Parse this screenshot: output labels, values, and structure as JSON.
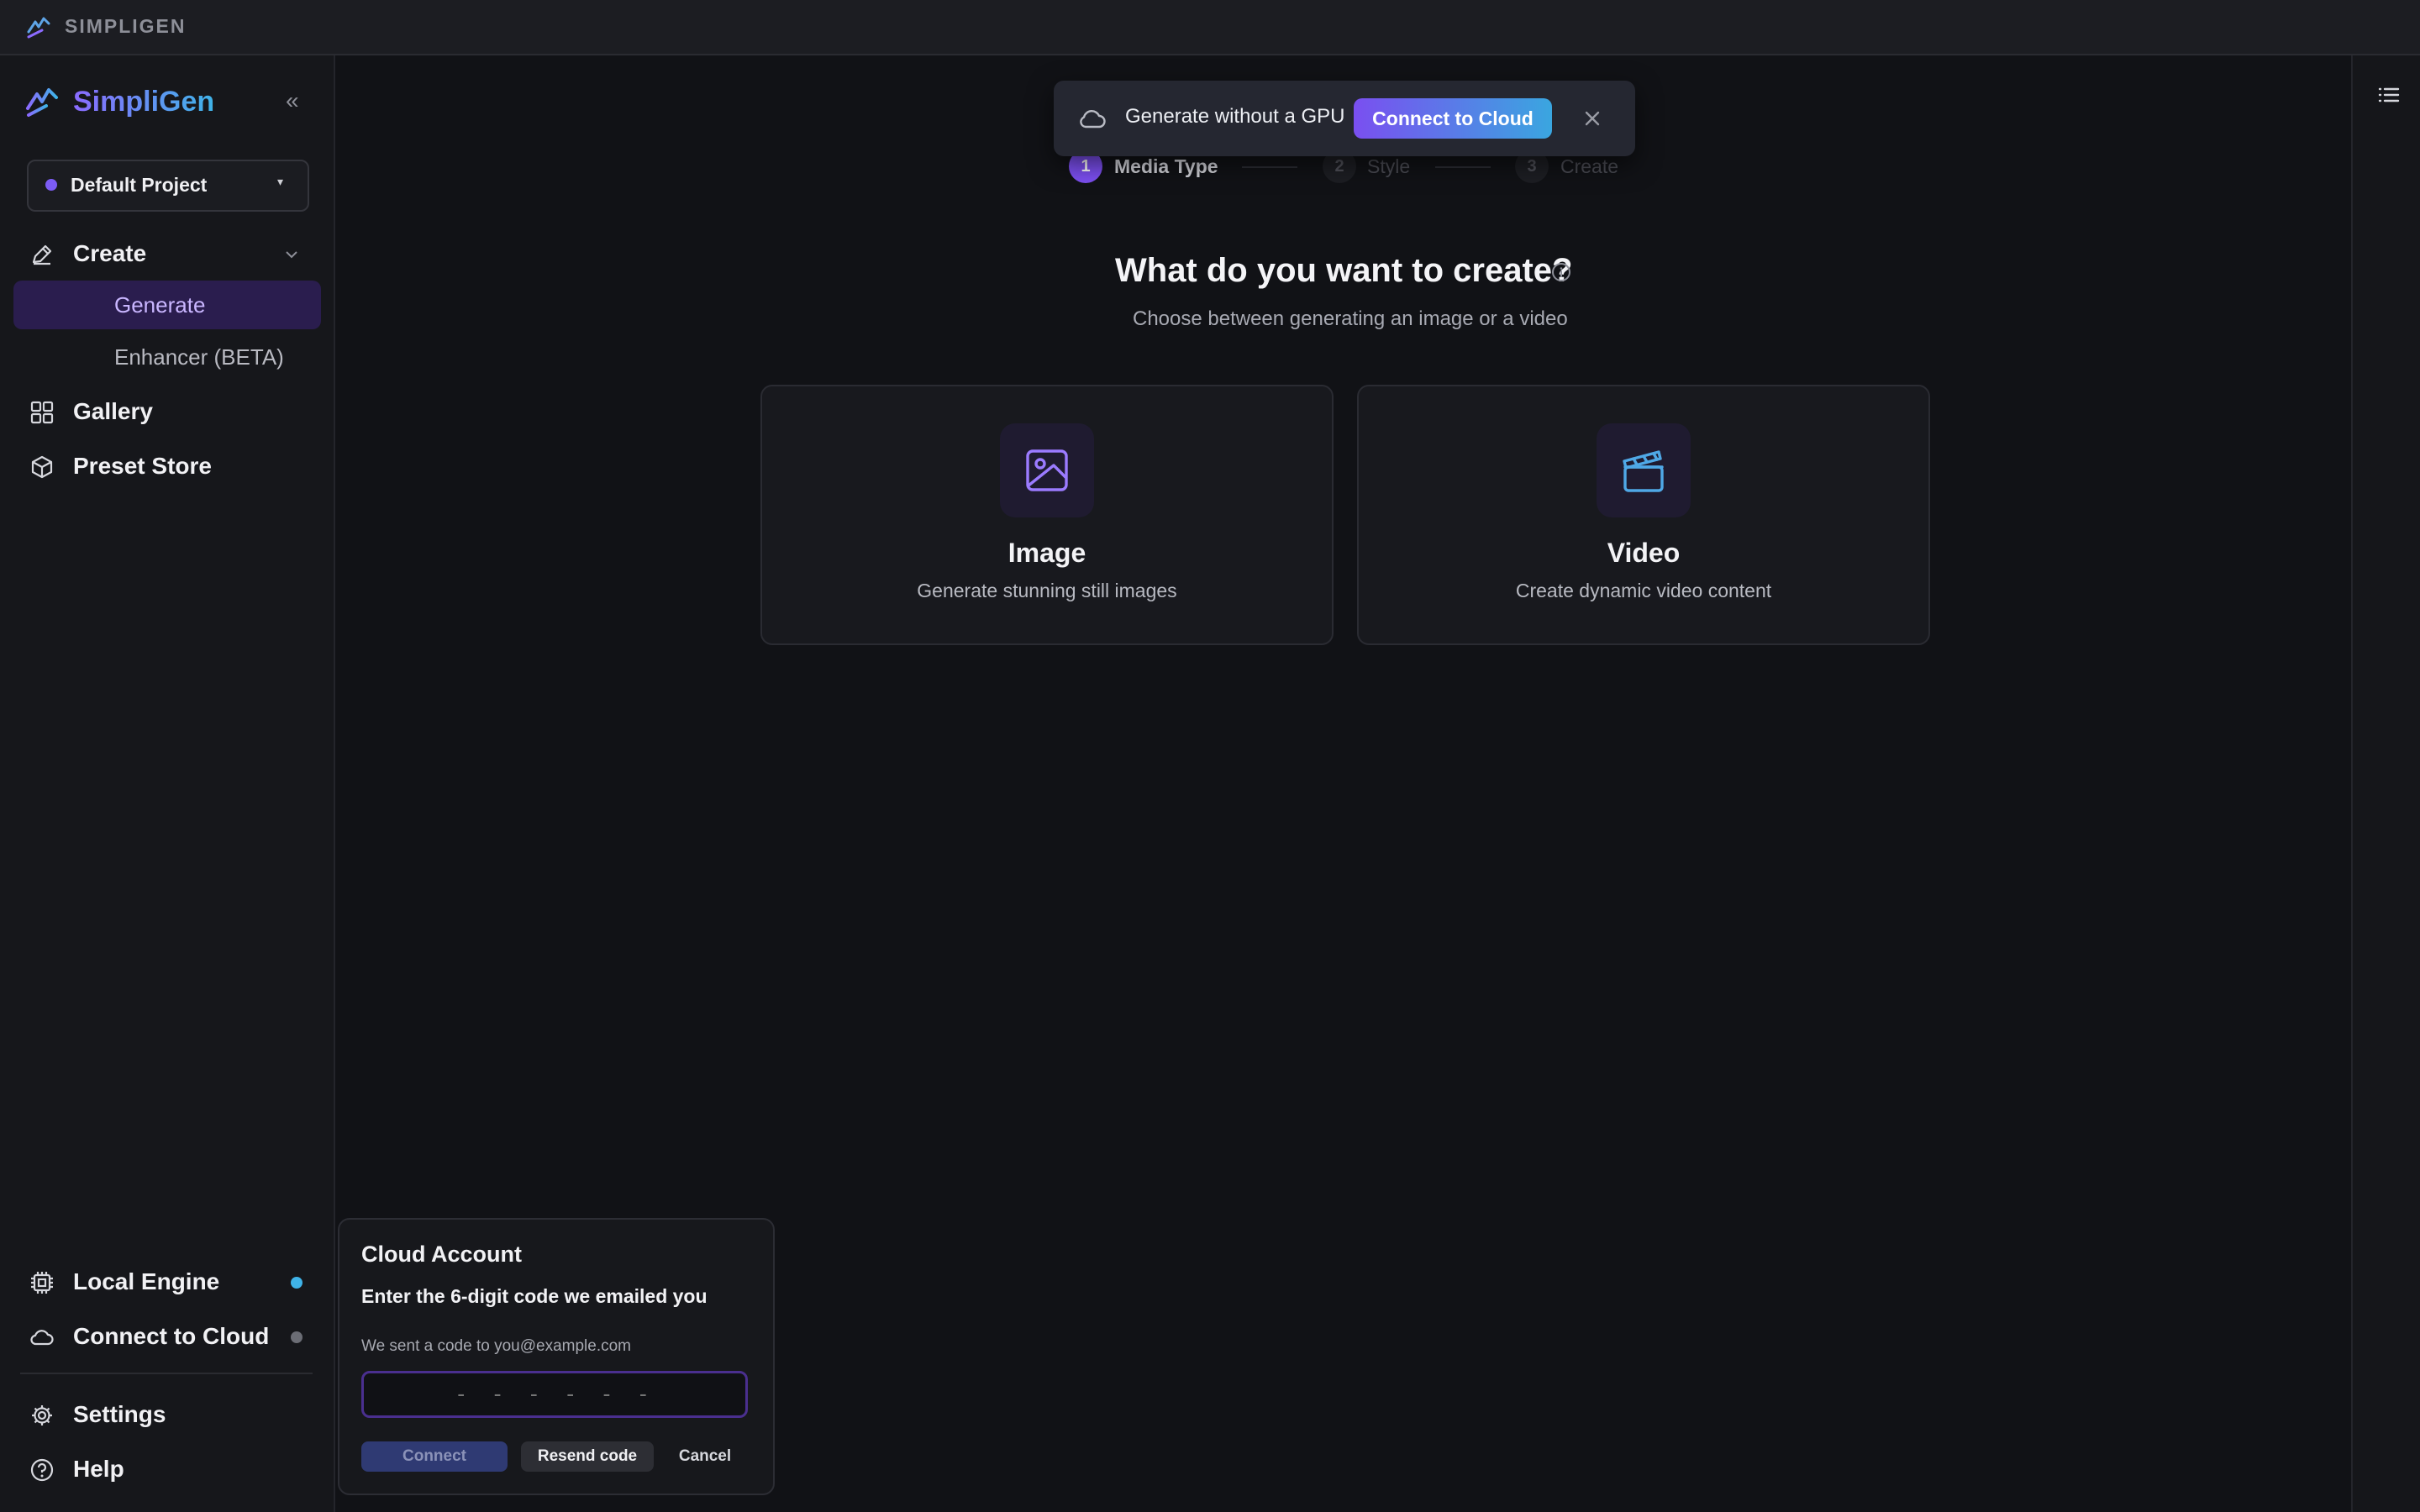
{
  "titlebar": {
    "app_name": "SIMPLIGEN"
  },
  "sidebar": {
    "brand": "SimpliGen",
    "collapse_glyph": "«",
    "project": {
      "name": "Default Project",
      "caret": "▾",
      "dot_color": "#7c5cf5"
    },
    "create": {
      "label": "Create",
      "icon": "pencil-icon",
      "expanded": true
    },
    "create_items": [
      {
        "label": "Generate",
        "active": true
      },
      {
        "label": "Enhancer (BETA)",
        "active": false
      }
    ],
    "gallery": {
      "label": "Gallery",
      "icon": "grid-icon"
    },
    "preset_store": {
      "label": "Preset Store",
      "icon": "cube-icon"
    },
    "local_engine": {
      "label": "Local Engine",
      "icon": "chip-icon",
      "status_color": "#3fb3e8"
    },
    "connect_cloud": {
      "label": "Connect to Cloud",
      "icon": "cloud-icon",
      "status_color": "#6b6d75"
    },
    "settings": {
      "label": "Settings",
      "icon": "gear-icon"
    },
    "help": {
      "label": "Help",
      "icon": "help-circle-icon"
    }
  },
  "banner": {
    "message": "Generate without a GPU",
    "cta": "Connect to Cloud",
    "icon": "cloud-icon"
  },
  "stepper": [
    {
      "num": "1",
      "label": "Media Type",
      "active": true
    },
    {
      "num": "2",
      "label": "Style",
      "active": false
    },
    {
      "num": "3",
      "label": "Create",
      "active": false
    }
  ],
  "main": {
    "title": "What do you want to create?",
    "subtitle": "Choose between generating an image or a video"
  },
  "cards": [
    {
      "title": "Image",
      "desc": "Generate stunning still images",
      "icon": "image-icon"
    },
    {
      "title": "Video",
      "desc": "Create dynamic video content",
      "icon": "clapperboard-icon"
    }
  ],
  "cloud_popover": {
    "title": "Cloud Account",
    "prompt": "Enter the 6-digit code we emailed you",
    "sent_to": "We sent a code to you@example.com",
    "code_placeholder": "- - - - - -",
    "connect": "Connect",
    "resend": "Resend code",
    "cancel": "Cancel"
  },
  "colors": {
    "accent": "#7c5cf5",
    "accent2": "#3fb3e8",
    "background": "#111216"
  }
}
